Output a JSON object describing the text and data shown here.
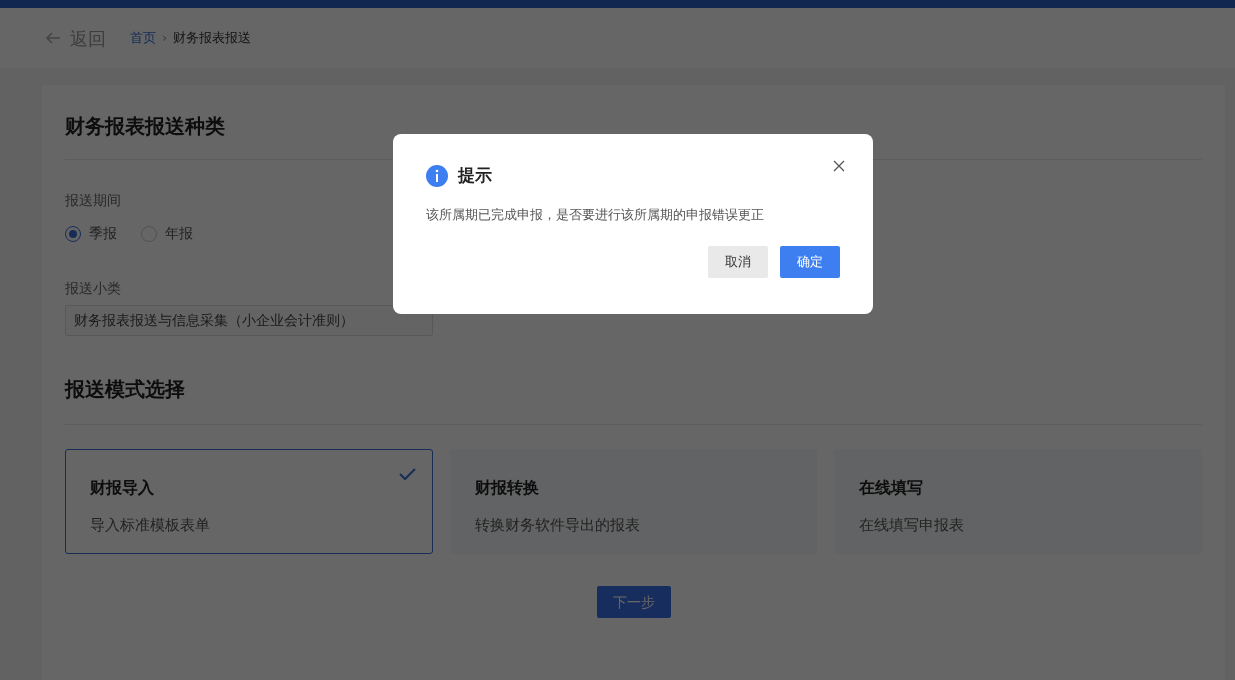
{
  "header": {
    "back": "返回",
    "separator": "›",
    "breadcrumb": [
      {
        "label": "首页",
        "link": true
      },
      {
        "label": "财务报表报送",
        "link": false
      }
    ]
  },
  "section_type": {
    "title": "财务报表报送种类",
    "period": {
      "label": "报送期间",
      "options": [
        {
          "label": "季报",
          "selected": true
        },
        {
          "label": "年报",
          "selected": false
        }
      ]
    },
    "subcategory": {
      "label": "报送小类",
      "value": "财务报表报送与信息采集（小企业会计准则）"
    }
  },
  "section_mode": {
    "title": "报送模式选择",
    "modes": [
      {
        "title": "财报导入",
        "description": "导入标准模板表单",
        "selected": true
      },
      {
        "title": "财报转换",
        "description": "转换财务软件导出的报表",
        "selected": false
      },
      {
        "title": "在线填写",
        "description": "在线填写申报表",
        "selected": false
      }
    ]
  },
  "next_button": "下一步",
  "dialog": {
    "title": "提示",
    "message": "该所属期已完成申报，是否要进行该所属期的申报错误更正",
    "buttons": [
      {
        "label": "取消",
        "kind": "secondary"
      },
      {
        "label": "确定",
        "kind": "primary"
      }
    ]
  }
}
